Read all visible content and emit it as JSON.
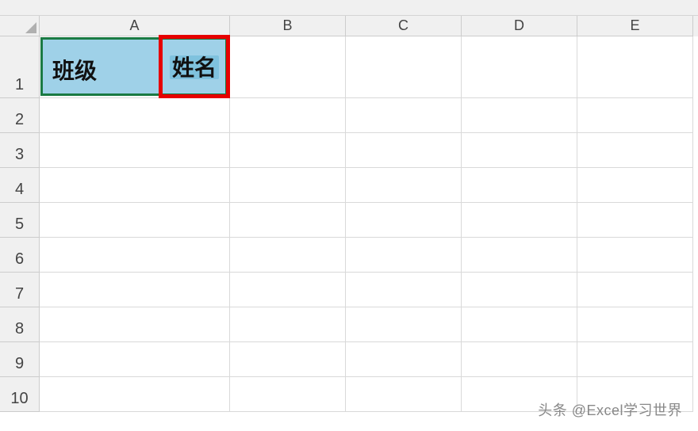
{
  "columns": {
    "A": "A",
    "B": "B",
    "C": "C",
    "D": "D",
    "E": "E"
  },
  "rows": {
    "r1": "1",
    "r2": "2",
    "r3": "3",
    "r4": "4",
    "r5": "5",
    "r6": "6",
    "r7": "7",
    "r8": "8",
    "r9": "9",
    "r10": "10"
  },
  "cellA1": {
    "left_label": "班级",
    "right_label": "姓名"
  },
  "watermark": "头条 @Excel学习世界",
  "selection": {
    "green_range": "A1",
    "red_highlight_on": "right_label"
  },
  "colors": {
    "fill_blue": "#9fd1e8",
    "border_green": "#1a7a43",
    "border_red": "#e60000",
    "inner_highlight": "#7fc2de"
  }
}
